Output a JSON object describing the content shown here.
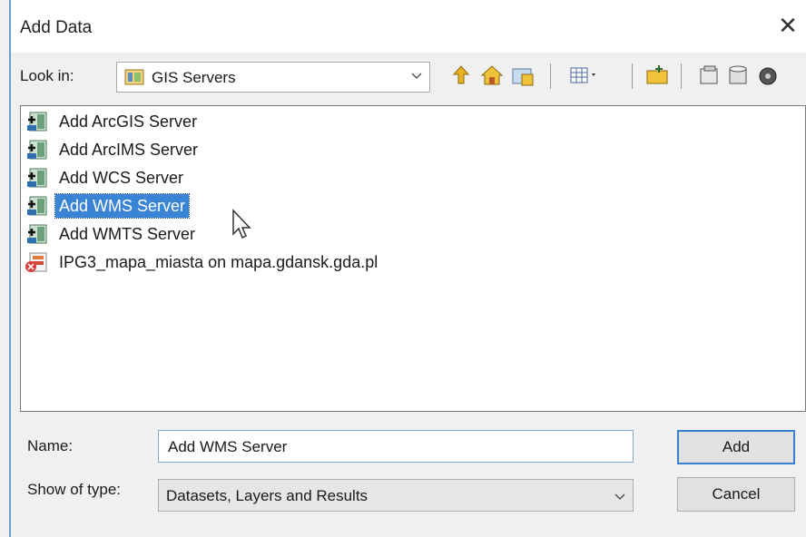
{
  "dialog": {
    "title": "Add Data"
  },
  "toolbar": {
    "look_in_label": "Look in:",
    "look_in_value": "GIS Servers"
  },
  "list": {
    "items": [
      {
        "label": "Add ArcGIS Server",
        "icon": "server-add-icon",
        "selected": false
      },
      {
        "label": "Add ArcIMS Server",
        "icon": "server-add-icon",
        "selected": false
      },
      {
        "label": "Add WCS Server",
        "icon": "server-add-icon",
        "selected": false
      },
      {
        "label": "Add WMS Server",
        "icon": "server-add-icon",
        "selected": true
      },
      {
        "label": "Add WMTS Server",
        "icon": "server-add-icon",
        "selected": false
      },
      {
        "label": "IPG3_mapa_miasta on mapa.gdansk.gda.pl",
        "icon": "wms-connection-icon",
        "selected": false
      }
    ]
  },
  "form": {
    "name_label": "Name:",
    "name_value": "Add WMS Server",
    "type_label": "Show of type:",
    "type_value": "Datasets, Layers and Results"
  },
  "buttons": {
    "add": "Add",
    "cancel": "Cancel"
  },
  "colors": {
    "selection": "#3a84d6",
    "window_accent": "#6a9bd1"
  }
}
